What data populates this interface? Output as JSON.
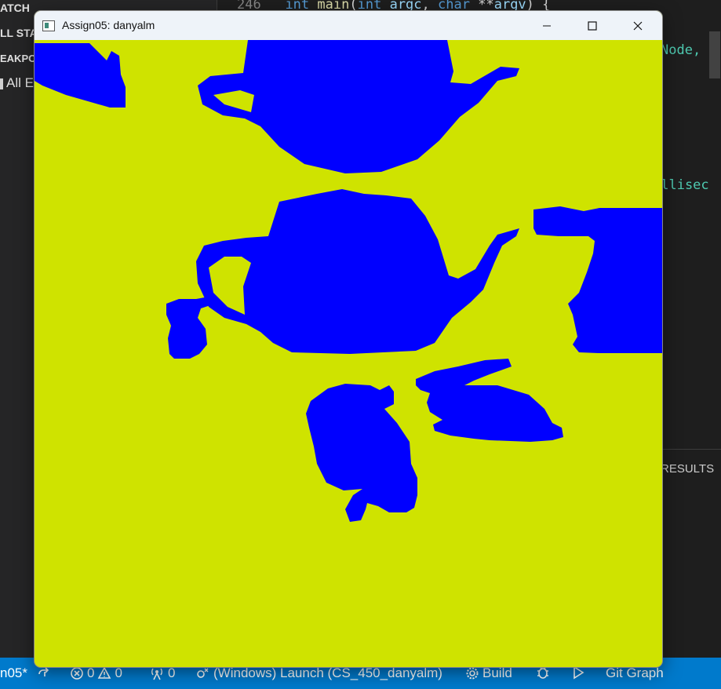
{
  "background": {
    "sidebar_fragments": [
      "ATCH",
      "LL STA",
      "EAKPO",
      "All E"
    ],
    "code": {
      "line_number": "246",
      "line_text": [
        "int",
        "main",
        "(",
        "int",
        "argc",
        ",",
        "char",
        "**",
        "argv",
        ")",
        "{"
      ],
      "fragment_node": "Node, g",
      "fragment_millis": "illisec"
    },
    "panel_tab": "RESULTS"
  },
  "window": {
    "title": "Assign05: danyalm",
    "controls": {
      "minimize": "minimize-icon",
      "maximize": "maximize-icon",
      "close": "close-icon"
    },
    "scene": {
      "background_color": "#cfe300",
      "object_color": "#0000ff",
      "objects": [
        "teapot",
        "teapot",
        "bunny",
        "bunny",
        "bunny",
        "bunny",
        "bunny"
      ]
    }
  },
  "statusbar": {
    "branch": "n05*",
    "errors": "0",
    "warnings": "0",
    "ports": "0",
    "launch": "(Windows) Launch (CS_450_danyalm)",
    "build": "Build",
    "git_graph": "Git Graph"
  }
}
